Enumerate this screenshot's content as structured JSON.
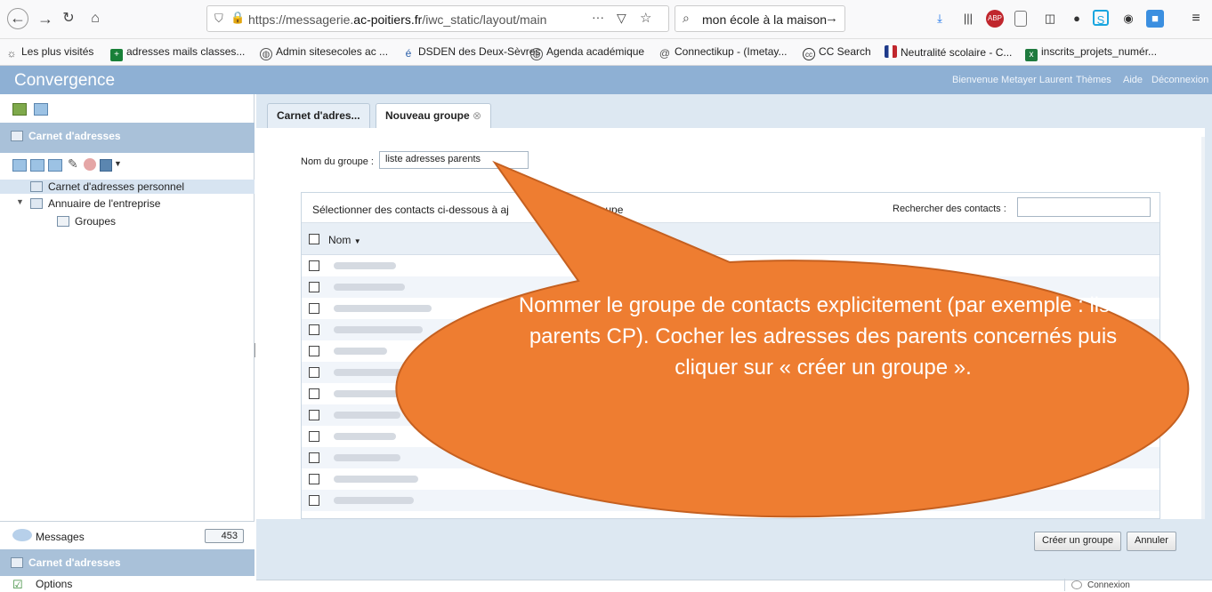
{
  "browser": {
    "url_prefix": "https://messagerie.",
    "url_domain": "ac-poitiers.fr",
    "url_path": "/iwc_static/layout/main",
    "search_value": "mon école à la maison",
    "bookmarks": [
      "Les plus visités",
      "adresses mails classes...",
      "Admin sitesecoles ac ...",
      "DSDEN des Deux-Sèvres",
      "Agenda académique",
      "Connectikup - (Imetay...",
      "CC Search",
      "Neutralité scolaire - C...",
      "inscrits_projets_numér..."
    ]
  },
  "app": {
    "title": "Convergence",
    "header_links": {
      "welcome": "Bienvenue Metayer Laurent",
      "themes": "Thèmes",
      "help": "Aide",
      "logout": "Déconnexion"
    }
  },
  "sidebar": {
    "section_title": "Carnet d'adresses",
    "tree": {
      "personal": "Carnet d'adresses personnel",
      "directory": "Annuaire de l'entreprise",
      "groups": "Groupes"
    },
    "bottom": {
      "messages_label": "Messages",
      "messages_count": "453",
      "address_book_label": "Carnet d'adresses",
      "options_label": "Options"
    }
  },
  "tabs": {
    "address_book": "Carnet d'adres...",
    "new_group": "Nouveau groupe"
  },
  "form": {
    "group_name_label": "Nom du groupe :",
    "group_name_value": "liste adresses parents",
    "select_instruction": "Sélectionner des contacts ci-dessous à aj",
    "select_instruction_end": "groupe",
    "search_contacts_label": "Rechercher des contacts :",
    "column_name": "Nom",
    "create_button": "Créer un groupe",
    "cancel_button": "Annuler"
  },
  "status": {
    "connection": "Connexion"
  },
  "callout": {
    "text": "Nommer le groupe de contacts explicitement (par exemple : liste parents CP). Cocher les adresses des parents concernés puis cliquer sur « créer un groupe ».",
    "fill_color": "#ee7d31",
    "stroke_color": "#c56020"
  },
  "colors": {
    "header_blue": "#8eb0d4",
    "pane_blue": "#dde8f2"
  }
}
